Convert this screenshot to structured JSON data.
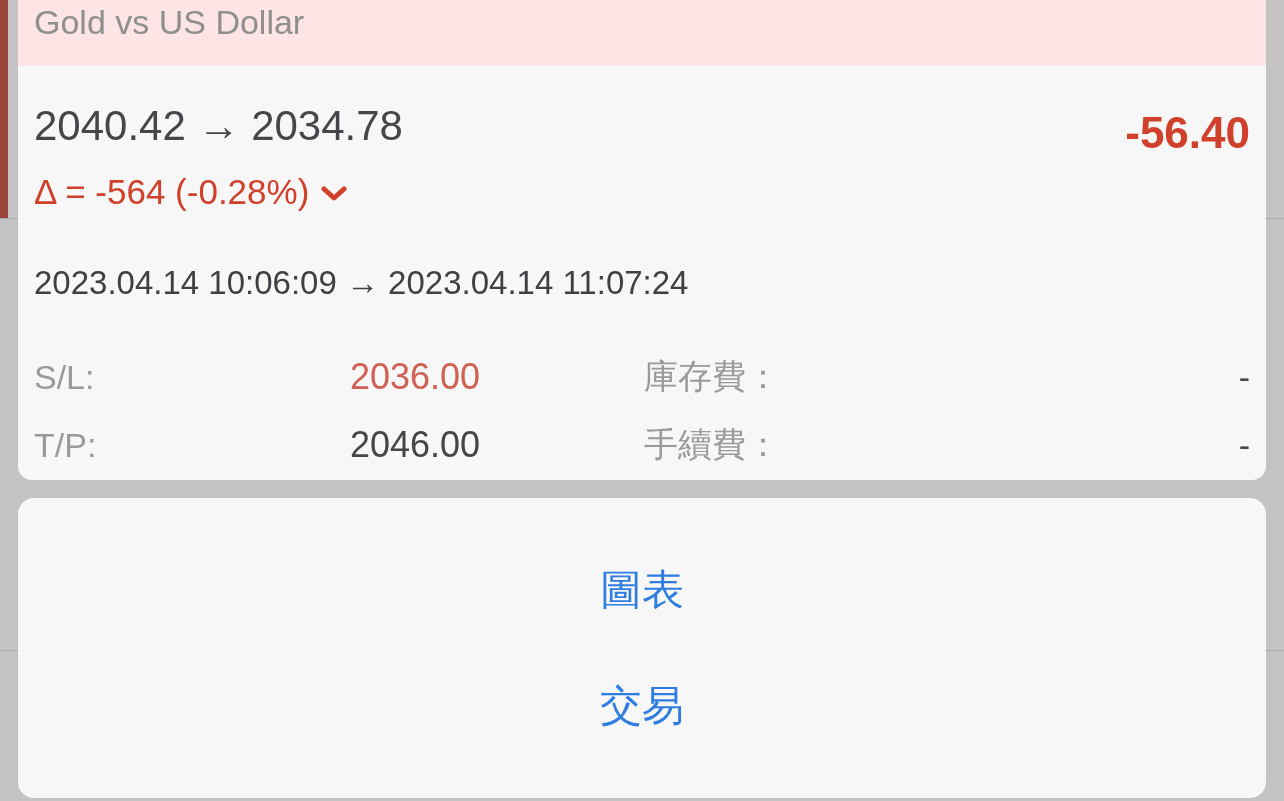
{
  "position": {
    "symbol_description": "Gold vs US Dollar",
    "price_open": "2040.42",
    "arrow": "→",
    "price_current": "2034.78",
    "profit": "-56.40",
    "delta": "Δ = -564 (-0.28%)",
    "time_open": "2023.04.14 10:06:09",
    "time_arrow": "→",
    "time_close": "2023.04.14 11:07:24",
    "levels": [
      {
        "label": "S/L:",
        "value": "2036.00",
        "kind": "stop_loss"
      },
      {
        "label": "T/P:",
        "value": "2046.00",
        "kind": "take_profit"
      }
    ],
    "charges": [
      {
        "label": "庫存費：",
        "value": "-"
      },
      {
        "label": "手續費：",
        "value": "-"
      }
    ]
  },
  "actions": [
    {
      "label": "圖表"
    },
    {
      "label": "交易"
    }
  ]
}
